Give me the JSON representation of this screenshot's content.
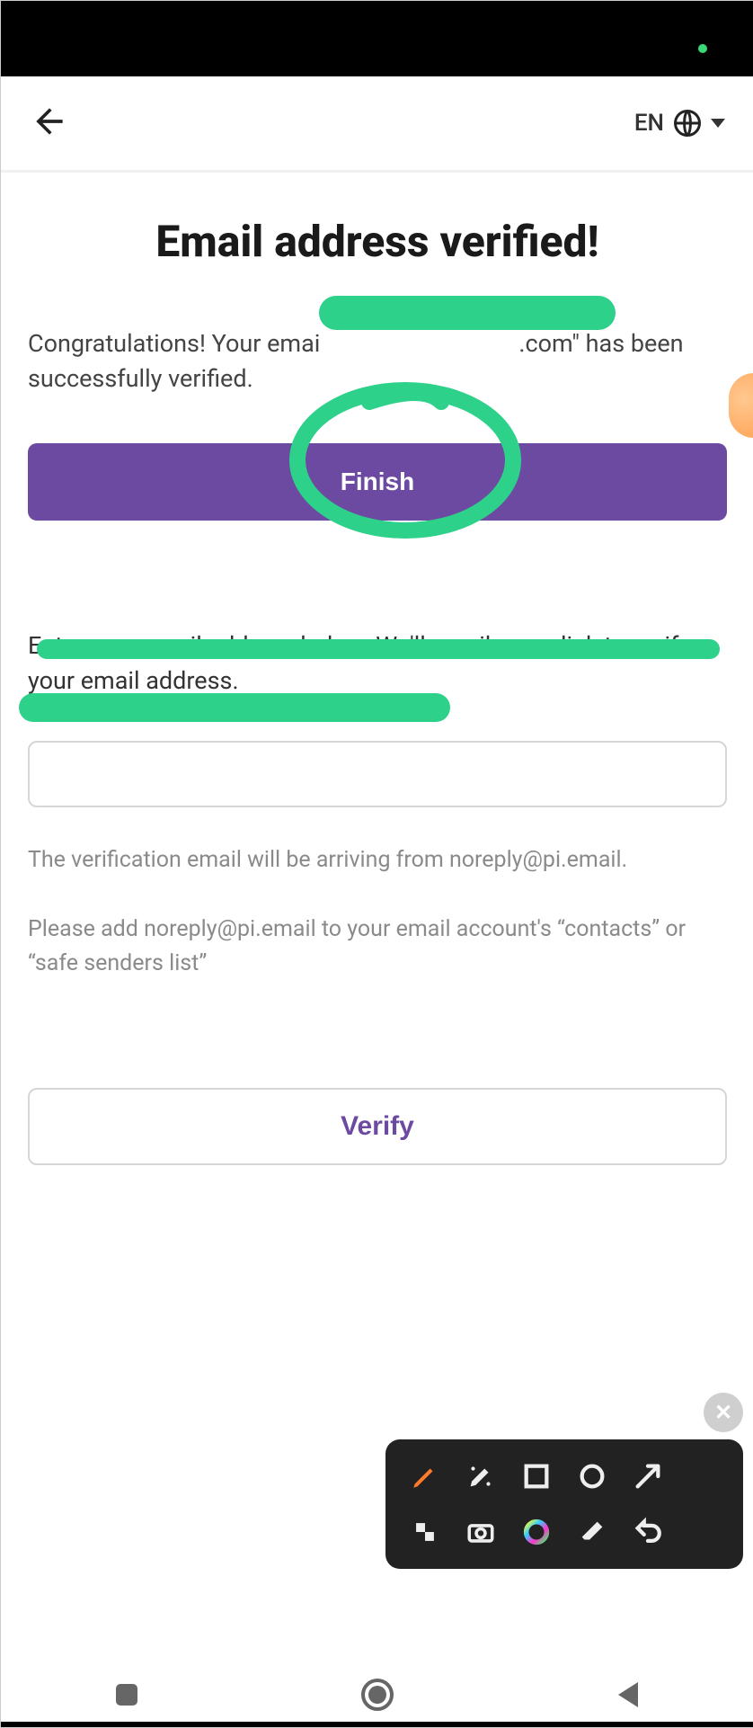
{
  "statusbar": {},
  "header": {
    "language_label": "EN"
  },
  "page": {
    "title": "Email address verified!",
    "congrats_pre": "Congratulations! Your emai",
    "congrats_post": ".com\" has been successfully verified.",
    "finish_label": "Finish",
    "instruction": "Enter your email address below. We'll email you a link to verify your email address.",
    "email_value": "",
    "note_line1": "The verification email will be arriving from noreply@pi.email.",
    "note_line2": "Please add noreply@pi.email to your email account's “contacts” or “safe senders list”",
    "verify_label": "Verify"
  },
  "annotation_toolbar": {
    "close": "✕",
    "tools": [
      "pen",
      "marker",
      "square",
      "circle",
      "arrow",
      "crop",
      "camera",
      "color",
      "eraser",
      "undo"
    ]
  }
}
